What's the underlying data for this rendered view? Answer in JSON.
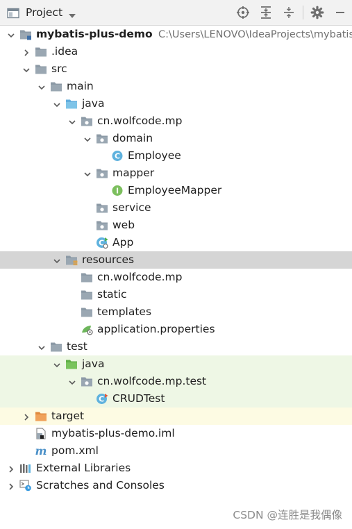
{
  "toolbar": {
    "title": "Project",
    "icons": [
      "project-window-icon",
      "dropdown-arrow-icon",
      "locate-icon",
      "expand-all-icon",
      "collapse-all-icon",
      "gear-icon",
      "minimize-icon"
    ]
  },
  "tree": [
    {
      "label": "mybatis-plus-demo",
      "path": "C:\\Users\\LENOVO\\IdeaProjects\\mybatis-p",
      "icon": "module-folder-icon",
      "expanded": true,
      "depth": 0,
      "bold": true
    },
    {
      "label": ".idea",
      "icon": "folder-icon",
      "expanded": false,
      "depth": 1
    },
    {
      "label": "src",
      "icon": "folder-icon",
      "expanded": true,
      "depth": 1
    },
    {
      "label": "main",
      "icon": "folder-icon",
      "expanded": true,
      "depth": 2
    },
    {
      "label": "java",
      "icon": "source-folder-icon",
      "expanded": true,
      "depth": 3
    },
    {
      "label": "cn.wolfcode.mp",
      "icon": "package-icon",
      "expanded": true,
      "depth": 4
    },
    {
      "label": "domain",
      "icon": "package-icon",
      "expanded": true,
      "depth": 5
    },
    {
      "label": "Employee",
      "icon": "class-icon",
      "depth": 6
    },
    {
      "label": "mapper",
      "icon": "package-icon",
      "expanded": true,
      "depth": 5
    },
    {
      "label": "EmployeeMapper",
      "icon": "interface-icon",
      "depth": 6
    },
    {
      "label": "service",
      "icon": "package-icon",
      "depth": 5
    },
    {
      "label": "web",
      "icon": "package-icon",
      "depth": 5
    },
    {
      "label": "App",
      "icon": "spring-app-class-icon",
      "depth": 5
    },
    {
      "label": "resources",
      "icon": "resources-folder-icon",
      "expanded": true,
      "depth": 3,
      "highlight": "selected"
    },
    {
      "label": "cn.wolfcode.mp",
      "icon": "folder-icon",
      "depth": 4
    },
    {
      "label": "static",
      "icon": "folder-icon",
      "depth": 4
    },
    {
      "label": "templates",
      "icon": "folder-icon",
      "depth": 4
    },
    {
      "label": "application.properties",
      "icon": "properties-file-icon",
      "depth": 4
    },
    {
      "label": "test",
      "icon": "folder-icon",
      "expanded": true,
      "depth": 2
    },
    {
      "label": "java",
      "icon": "test-folder-icon",
      "expanded": true,
      "depth": 3,
      "highlight": "test"
    },
    {
      "label": "cn.wolfcode.mp.test",
      "icon": "package-icon",
      "expanded": true,
      "depth": 4,
      "highlight": "test"
    },
    {
      "label": "CRUDTest",
      "icon": "test-class-icon",
      "depth": 5,
      "highlight": "test"
    },
    {
      "label": "target",
      "icon": "excluded-folder-icon",
      "expanded": false,
      "depth": 1,
      "highlight": "excluded"
    },
    {
      "label": "mybatis-plus-demo.iml",
      "icon": "iml-file-icon",
      "depth": 1
    },
    {
      "label": "pom.xml",
      "icon": "maven-icon",
      "depth": 1
    },
    {
      "label": "External Libraries",
      "icon": "libraries-icon",
      "expanded": false,
      "depth": 0
    },
    {
      "label": "Scratches and Consoles",
      "icon": "scratches-icon",
      "expanded": false,
      "depth": 0
    }
  ],
  "watermark": "CSDN @连胜是我偶像",
  "colors": {
    "selected_row": "#d5d5d5",
    "test_row": "#eef7e5",
    "excluded_row": "#fdfbe3",
    "folder_gray": "#8c9aa6",
    "source_blue": "#7fc4e8",
    "test_green": "#79c35c",
    "excluded_orange": "#f0a25a",
    "class_blue": "#5fb2de",
    "interface_green": "#7cbf5e"
  }
}
